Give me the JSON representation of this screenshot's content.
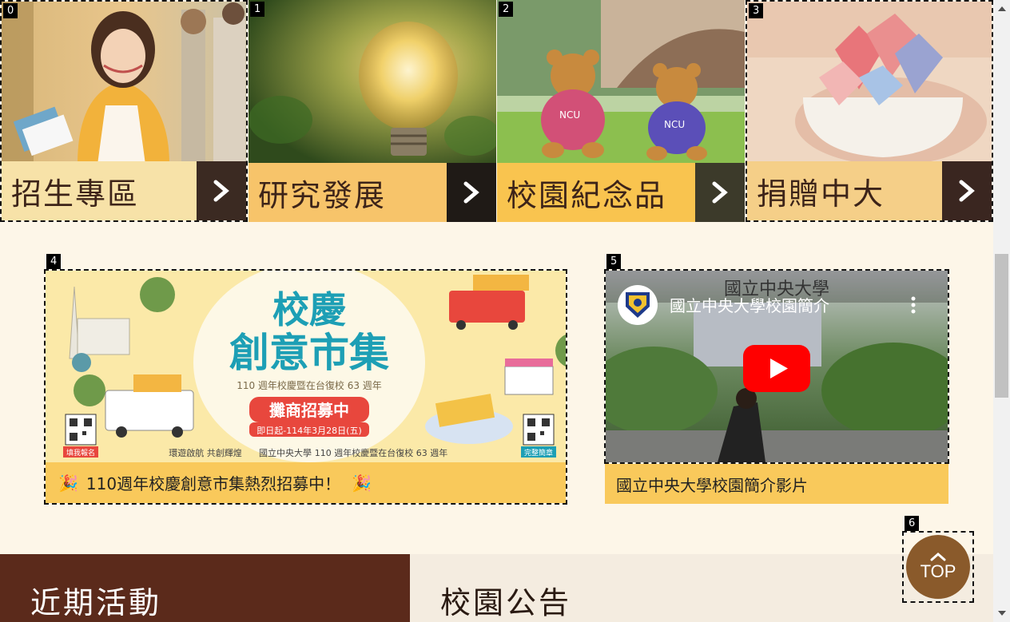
{
  "tiles": [
    {
      "badge": "0",
      "label": "招生專區",
      "bar_color": "#f7e2a8",
      "arrow_bg": "#3b2a22"
    },
    {
      "badge": "1",
      "label": "研究發展",
      "bar_color": "#f7c46a",
      "arrow_bg": "#1f1a16"
    },
    {
      "badge": "2",
      "label": "校園紀念品",
      "bar_color": "#f9c44f",
      "arrow_bg": "#3c3a2a"
    },
    {
      "badge": "3",
      "label": "捐贈中大",
      "bar_color": "#f5cf88",
      "arrow_bg": "#3a2620"
    }
  ],
  "market_card": {
    "badge": "4",
    "caption": "110週年校慶創意市集熱烈招募中！",
    "poster": {
      "title_line1": "校慶",
      "title_line2": "創意市集",
      "subtitle": "110 週年校慶暨在台復校 63 週年",
      "banner": "攤商招募中",
      "banner_date": "即日起-114年3月28日(五)",
      "signup_label": "填我報名",
      "info_label": "完整簡章",
      "footer_slogan": "環遊啟航 共創輝煌",
      "footer_org": "國立中央大學",
      "footer_text": "110 週年校慶暨在台復校 63 週年"
    }
  },
  "video_card": {
    "badge": "5",
    "video_title": "國立中央大學校園簡介",
    "watermark": "國立中央大學",
    "caption": "國立中央大學校園簡介影片"
  },
  "sections": {
    "events_title": "近期活動",
    "news_title": "校園公告"
  },
  "top_button": {
    "badge": "6",
    "label": "TOP"
  },
  "colors": {
    "page_bg": "#fdf6e8",
    "caption_bg": "#f9c95b",
    "events_bg": "#5b2a1b",
    "news_bg": "#f4ece0",
    "youtube_red": "#ff0000"
  }
}
